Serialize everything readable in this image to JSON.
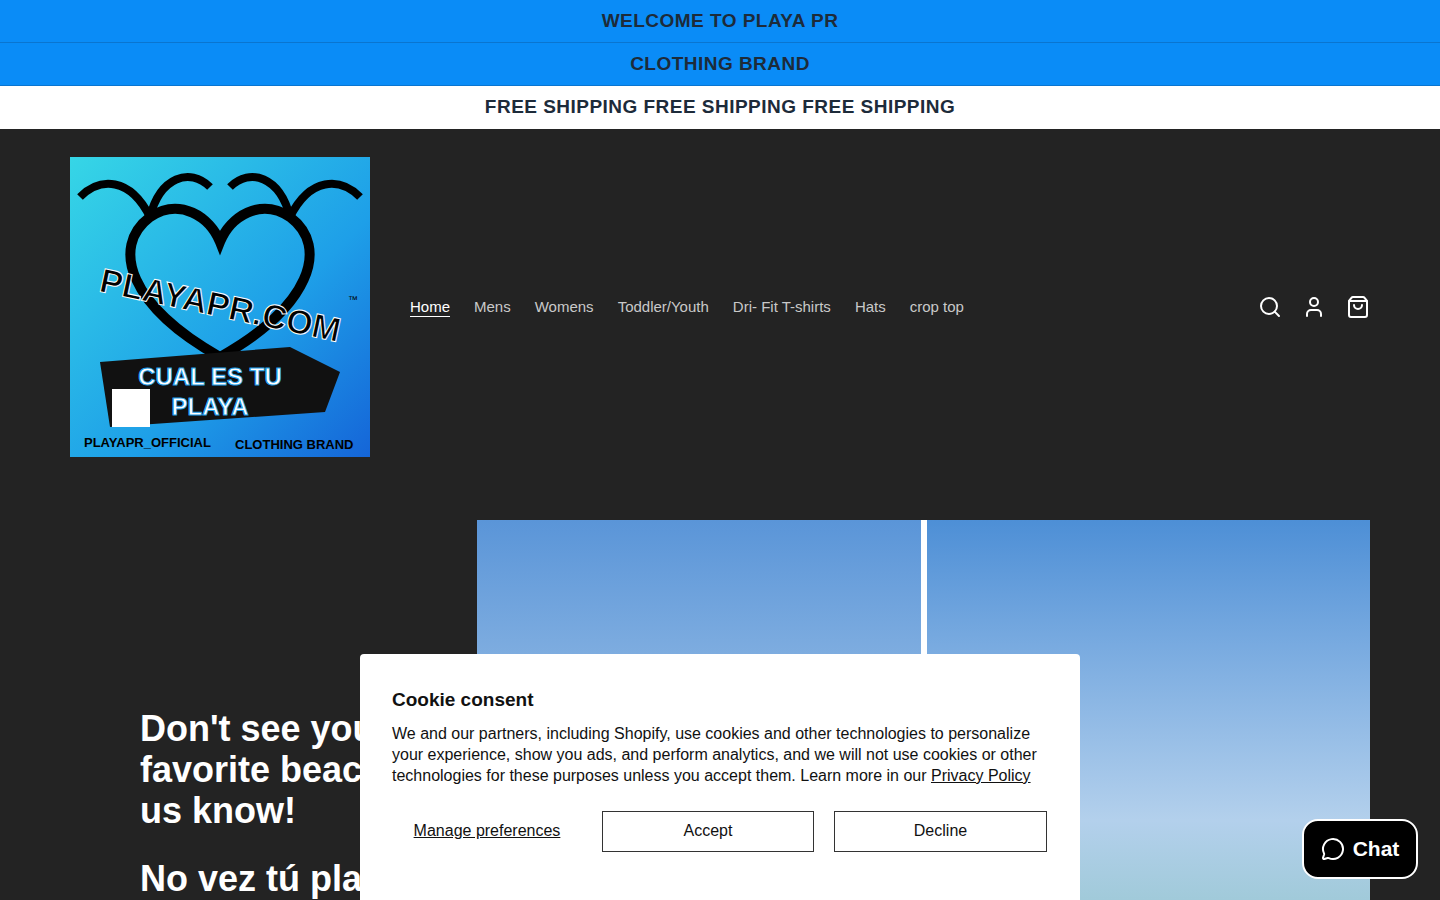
{
  "announcements": [
    {
      "text": "WELCOME TO PLAYA PR",
      "kind": "blue"
    },
    {
      "text": "CLOTHING BRAND",
      "kind": "blue"
    },
    {
      "text": "FREE SHIPPING FREE SHIPPING FREE SHIPPING",
      "kind": "white"
    }
  ],
  "logo": {
    "title": "PLAYAPR.COM",
    "tm": "™",
    "tagline_1": "CUAL ES TU",
    "tagline_2": "PLAYA",
    "handle": "PLAYAPR_OFFICIAL",
    "brand": "CLOTHING BRAND"
  },
  "nav": [
    {
      "label": "Home",
      "selected": true
    },
    {
      "label": "Mens",
      "selected": false
    },
    {
      "label": "Womens",
      "selected": false
    },
    {
      "label": "Toddler/Youth",
      "selected": false
    },
    {
      "label": "Dri- Fit T-shirts",
      "selected": false
    },
    {
      "label": "Hats",
      "selected": false
    },
    {
      "label": "crop top",
      "selected": false
    }
  ],
  "hero": {
    "heading_lines": [
      "Don't see your",
      "favorite beach?",
      "us know!"
    ],
    "subheading": "No vez tú playa"
  },
  "cookie": {
    "title": "Cookie consent",
    "body": "We and our partners, including Shopify, use cookies and other technologies to personalize your experience, show you ads, and perform analytics, and we will not use cookies or other technologies for these purposes unless you accept them. Learn more in our",
    "link": "Privacy Policy",
    "manage": "Manage preferences",
    "accept": "Accept",
    "decline": "Decline"
  },
  "chat": {
    "label": "Chat"
  }
}
